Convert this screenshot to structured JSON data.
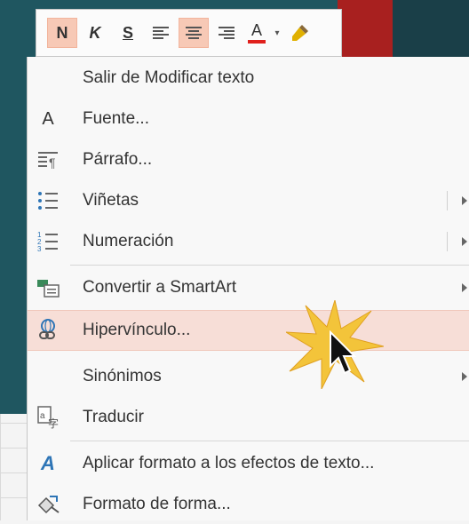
{
  "toolbar": {
    "buttons": [
      {
        "label": "N",
        "name": "bold-button",
        "active": true
      },
      {
        "label": "K",
        "name": "italic-button",
        "active": false
      },
      {
        "label": "S",
        "name": "underline-button",
        "active": false
      }
    ],
    "font_color_label": "A"
  },
  "menu": {
    "items": [
      {
        "label": "Salir de Modificar texto",
        "icon": "none"
      },
      {
        "label": "Fuente...",
        "icon": "font-icon",
        "icon_text": "A"
      },
      {
        "label": "Párrafo...",
        "icon": "paragraph-icon"
      },
      {
        "label": "Viñetas",
        "icon": "bullets-icon",
        "submenu": true
      },
      {
        "label": "Numeración",
        "icon": "numbering-icon",
        "submenu": true
      },
      {
        "label": "Convertir a SmartArt",
        "icon": "smartart-icon",
        "submenu": true
      },
      {
        "label": "Hipervínculo...",
        "icon": "hyperlink-icon",
        "hovered": true
      },
      {
        "label": "Sinónimos",
        "icon": "none",
        "submenu": true
      },
      {
        "label": "Traducir",
        "icon": "translate-icon"
      },
      {
        "label": "Aplicar formato a los efectos de texto...",
        "icon": "text-effects-icon",
        "icon_text": "A"
      },
      {
        "label": "Formato de forma...",
        "icon": "format-shape-icon"
      }
    ]
  },
  "colors": {
    "hover_bg": "#f7ded7",
    "active_btn": "#f7c9b6",
    "accent_blue": "#2e75b6",
    "slide_bg": "#1f5660",
    "slide_red": "#a8201f"
  }
}
